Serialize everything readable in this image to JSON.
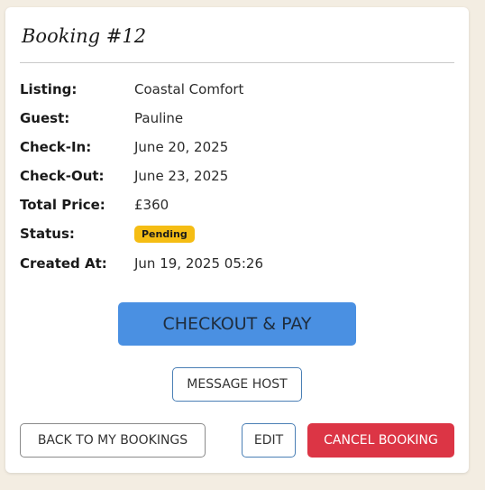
{
  "booking": {
    "title": "Booking #12",
    "fields": [
      {
        "label": "Listing:",
        "value": "Coastal Comfort"
      },
      {
        "label": "Guest:",
        "value": "Pauline"
      },
      {
        "label": "Check-In:",
        "value": "June 20, 2025"
      },
      {
        "label": "Check-Out:",
        "value": "June 23, 2025"
      },
      {
        "label": "Total Price:",
        "value": "£360"
      },
      {
        "label": "Status:",
        "value": "Pending"
      },
      {
        "label": "Created At:",
        "value": "Jun 19, 2025 05:26"
      }
    ]
  },
  "actions": {
    "checkout_label": "CHECKOUT & PAY",
    "message_host_label": "MESSAGE HOST",
    "back_label": "BACK TO MY BOOKINGS",
    "edit_label": "EDIT",
    "cancel_label": "CANCEL BOOKING"
  },
  "colors": {
    "page_background": "#f3ede2",
    "checkout_blue": "#4a90e2",
    "status_pending": "#f5bd14",
    "cancel_red": "#dc3545"
  }
}
